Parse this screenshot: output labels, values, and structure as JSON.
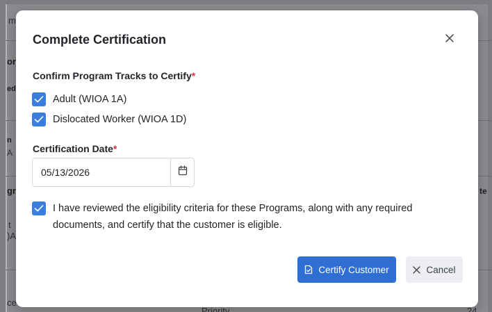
{
  "background": {
    "fragments": [
      {
        "text": "m"
      },
      {
        "text": "or"
      },
      {
        "text": "ed"
      },
      {
        "text": "n"
      },
      {
        "text": "A"
      },
      {
        "text": "gr"
      },
      {
        "text": "t"
      },
      {
        "text": ")A"
      },
      {
        "text": "te"
      },
      {
        "text": "ce"
      },
      {
        "text": "Priority"
      },
      {
        "text": "24"
      }
    ]
  },
  "modal": {
    "title": "Complete Certification",
    "close_icon": "close-icon",
    "tracks_section": {
      "label": "Confirm Program Tracks to Certify",
      "required_mark": "*",
      "options": [
        {
          "label": "Adult (WIOA 1A)",
          "checked": true
        },
        {
          "label": "Dislocated Worker (WIOA 1D)",
          "checked": true
        }
      ]
    },
    "date_section": {
      "label": "Certification Date",
      "required_mark": "*",
      "value": "05/13/2026",
      "icon": "calendar-icon"
    },
    "attestation": {
      "checked": true,
      "text": "I have reviewed the eligibility criteria for these Programs, along with any required documents, and certify that the customer is eligible."
    },
    "footer": {
      "certify_label": "Certify Customer",
      "certify_icon": "document-check-icon",
      "cancel_label": "Cancel",
      "cancel_icon": "close-icon"
    }
  },
  "colors": {
    "primary": "#2f6fd4",
    "checkbox": "#3b7ddd",
    "required": "#d0342c",
    "overlay": "#7b7d80"
  }
}
